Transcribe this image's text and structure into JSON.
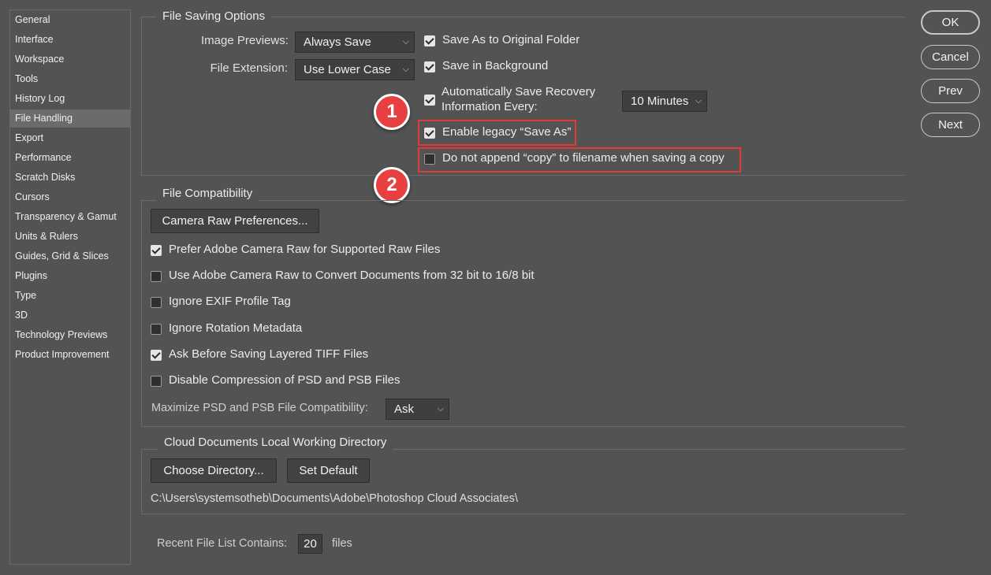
{
  "sidebar": {
    "items": [
      {
        "label": "General"
      },
      {
        "label": "Interface"
      },
      {
        "label": "Workspace"
      },
      {
        "label": "Tools"
      },
      {
        "label": "History Log"
      },
      {
        "label": "File Handling",
        "active": true
      },
      {
        "label": "Export"
      },
      {
        "label": "Performance"
      },
      {
        "label": "Scratch Disks"
      },
      {
        "label": "Cursors"
      },
      {
        "label": "Transparency & Gamut"
      },
      {
        "label": "Units & Rulers"
      },
      {
        "label": "Guides, Grid & Slices"
      },
      {
        "label": "Plugins"
      },
      {
        "label": "Type"
      },
      {
        "label": "3D"
      },
      {
        "label": "Technology Previews"
      },
      {
        "label": "Product Improvement"
      }
    ]
  },
  "file_saving": {
    "legend": "File Saving Options",
    "image_previews_label": "Image Previews:",
    "image_previews_value": "Always Save",
    "file_extension_label": "File Extension:",
    "file_extension_value": "Use Lower Case",
    "save_to_original": {
      "label": "Save As to Original Folder",
      "checked": true
    },
    "save_background": {
      "label": "Save in Background",
      "checked": true
    },
    "auto_save": {
      "label_line1": "Automatically Save Recovery",
      "label_line2": "Information Every:",
      "checked": true
    },
    "auto_save_interval": "10 Minutes",
    "legacy_save_as": {
      "label": "Enable legacy “Save As”",
      "checked": true
    },
    "no_copy_append": {
      "label": "Do not append “copy” to filename when saving a copy",
      "checked": false
    }
  },
  "callouts": {
    "one": "1",
    "two": "2",
    "color": "#e03a3a"
  },
  "file_compat": {
    "legend": "File Compatibility",
    "camera_raw_button": "Camera Raw Preferences...",
    "options": [
      {
        "label": "Prefer Adobe Camera Raw for Supported Raw Files",
        "checked": true
      },
      {
        "label": "Use Adobe Camera Raw to Convert Documents from 32 bit to 16/8 bit",
        "checked": false
      },
      {
        "label": "Ignore EXIF Profile Tag",
        "checked": false
      },
      {
        "label": "Ignore Rotation Metadata",
        "checked": false
      },
      {
        "label": "Ask Before Saving Layered TIFF Files",
        "checked": true
      },
      {
        "label": "Disable Compression of PSD and PSB Files",
        "checked": false
      }
    ],
    "maximize_label": "Maximize PSD and PSB File Compatibility:",
    "maximize_value": "Ask"
  },
  "cloud": {
    "legend": "Cloud Documents Local Working Directory",
    "choose_button": "Choose Directory...",
    "default_button": "Set Default",
    "path": "C:\\Users\\systemsotheb\\Documents\\Adobe\\Photoshop Cloud Associates\\"
  },
  "recent": {
    "label": "Recent File List Contains:",
    "value": "20",
    "suffix": "files"
  },
  "actions": {
    "ok": "OK",
    "cancel": "Cancel",
    "prev": "Prev",
    "next": "Next"
  }
}
